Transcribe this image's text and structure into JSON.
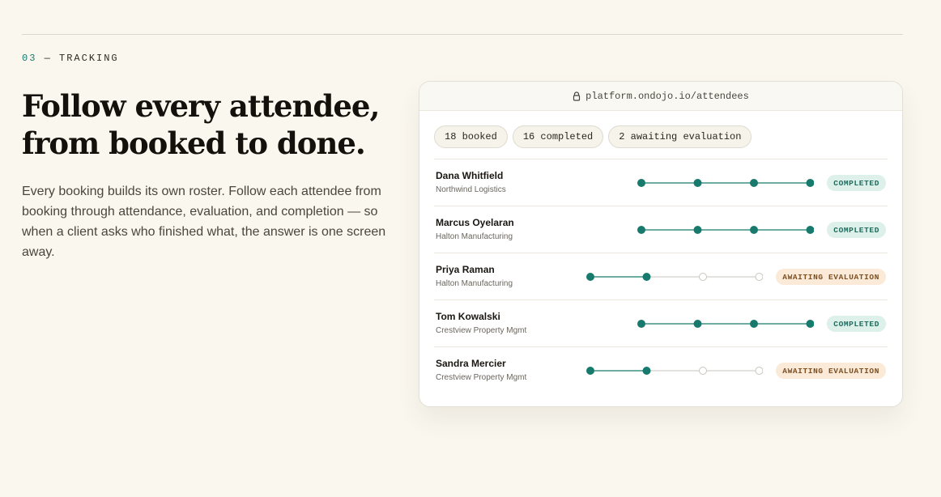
{
  "section": {
    "number": "03",
    "separator": "—",
    "label": "TRACKING"
  },
  "headline": "Follow every attendee, from booked to done.",
  "body": "Every booking builds its own roster. Follow each attendee from booking through attendance, evaluation, and completion — so when a client asks who finished what, the answer is one screen away.",
  "browser": {
    "url": "platform.ondojo.io/attendees",
    "lock_icon": "lock-icon"
  },
  "chips": [
    {
      "label": "18 booked"
    },
    {
      "label": "16 completed"
    },
    {
      "label": "2 awaiting evaluation"
    }
  ],
  "colors": {
    "accent": "#177a6c",
    "pending_dot": "#c8c5bc",
    "completed_badge_bg": "#ddf0ea",
    "awaiting_badge_bg": "#fbead7"
  },
  "attendees": [
    {
      "name": "Dana Whitfield",
      "company": "Northwind Logistics",
      "steps_done": 4,
      "steps_total": 4,
      "status": "COMPLETED",
      "status_kind": "completed"
    },
    {
      "name": "Marcus Oyelaran",
      "company": "Halton Manufacturing",
      "steps_done": 4,
      "steps_total": 4,
      "status": "COMPLETED",
      "status_kind": "completed"
    },
    {
      "name": "Priya Raman",
      "company": "Halton Manufacturing",
      "steps_done": 2,
      "steps_total": 4,
      "status": "AWAITING EVALUATION",
      "status_kind": "awaiting"
    },
    {
      "name": "Tom Kowalski",
      "company": "Crestview Property Mgmt",
      "steps_done": 4,
      "steps_total": 4,
      "status": "COMPLETED",
      "status_kind": "completed"
    },
    {
      "name": "Sandra Mercier",
      "company": "Crestview Property Mgmt",
      "steps_done": 2,
      "steps_total": 4,
      "status": "AWAITING EVALUATION",
      "status_kind": "awaiting"
    }
  ]
}
